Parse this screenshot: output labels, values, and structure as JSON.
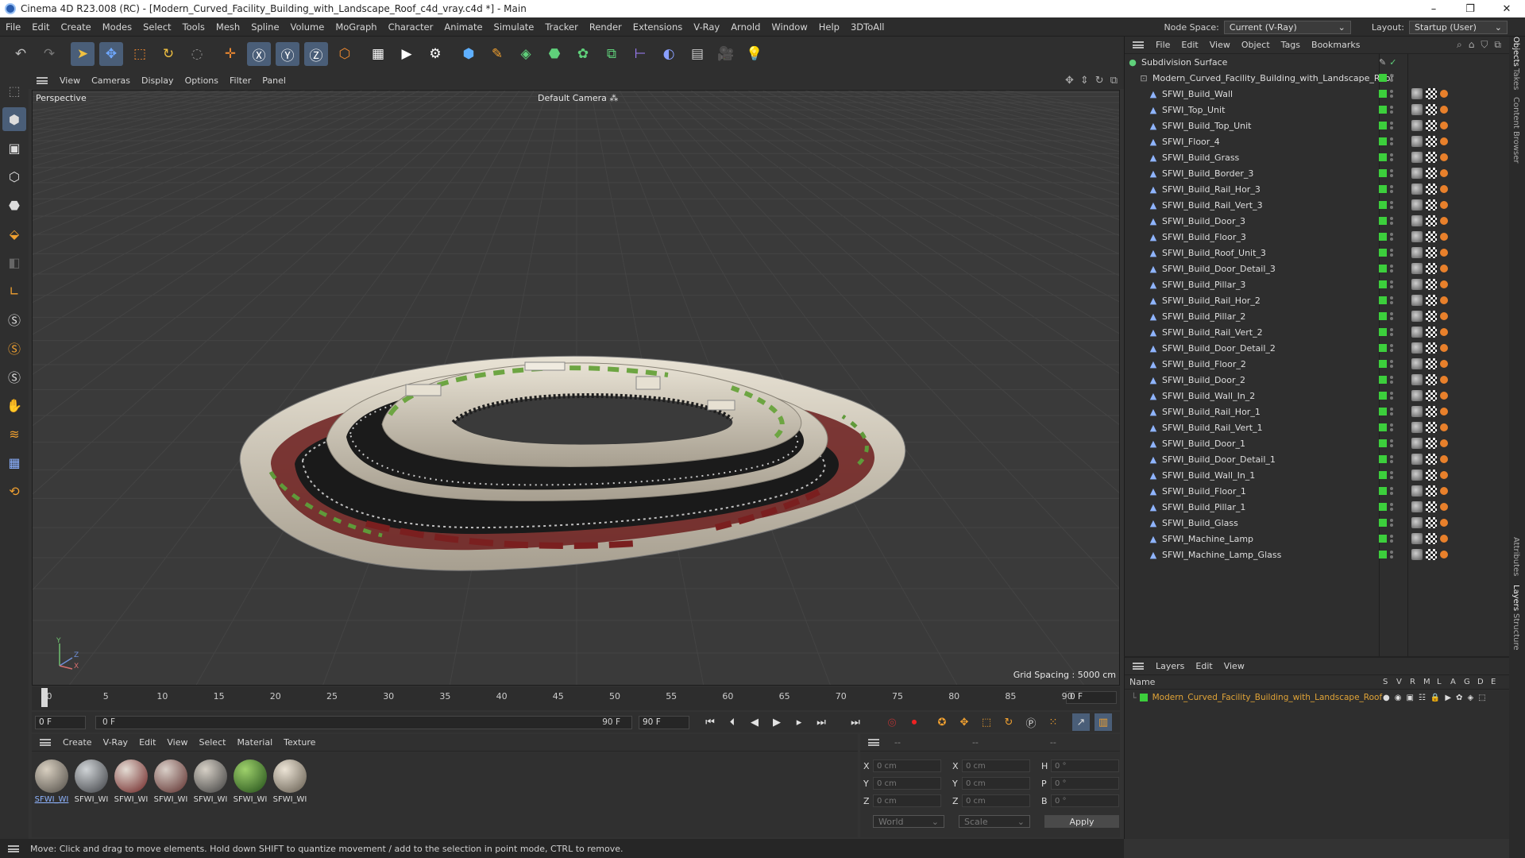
{
  "window": {
    "title": "Cinema 4D R23.008 (RC) - [Modern_Curved_Facility_Building_with_Landscape_Roof_c4d_vray.c4d *] - Main",
    "controls": [
      "–",
      "❐",
      "✕"
    ]
  },
  "menubar": {
    "items": [
      "File",
      "Edit",
      "Create",
      "Modes",
      "Select",
      "Tools",
      "Mesh",
      "Spline",
      "Volume",
      "MoGraph",
      "Character",
      "Animate",
      "Simulate",
      "Tracker",
      "Render",
      "Extensions",
      "V-Ray",
      "Arnold",
      "Window",
      "Help",
      "3DToAll"
    ],
    "node_space_label": "Node Space:",
    "node_space_value": "Current (V-Ray)",
    "layout_label": "Layout:",
    "layout_value": "Startup (User)"
  },
  "toolbar": {
    "icons": [
      "undo-icon",
      "redo-icon",
      "live-select-icon",
      "move-icon",
      "scale-icon",
      "rotate-icon",
      "recent-tool-icon",
      "axis-icon",
      "x-axis-icon",
      "y-axis-icon",
      "z-axis-icon",
      "coordinate-system-icon",
      "render-region-icon",
      "render-view-icon",
      "render-settings-icon",
      "cube-icon",
      "pen-icon",
      "subdivision-icon",
      "extrude-icon",
      "cloner-icon",
      "bend-icon",
      "measure-icon",
      "field-icon",
      "floor-icon",
      "camera-icon",
      "light-icon"
    ],
    "glyphs": [
      "↶",
      "↷",
      "➤",
      "✥",
      "⬚",
      "↻",
      "◌",
      "✛",
      "Ⓧ",
      "Ⓨ",
      "Ⓩ",
      "⬡",
      "▦",
      "▶",
      "⚙",
      "⬢",
      "✎",
      "◈",
      "⬣",
      "✿",
      "⧉",
      "⊢",
      "◐",
      "▤",
      "🎥",
      "💡"
    ]
  },
  "left_tools": {
    "icons": [
      "make-editable-icon",
      "model-mode-icon",
      "texture-mode-icon",
      "points-mode-icon",
      "edges-mode-icon",
      "polygons-mode-icon",
      "object-axis-icon",
      "workplane-icon",
      "snap-icon-1",
      "snap-icon-2",
      "snap-icon-3",
      "magnet-icon",
      "layer-floor-icon",
      "grid-icon",
      "soft-selection-icon"
    ],
    "glyphs": [
      "⬚",
      "⬢",
      "▣",
      "⬡",
      "⬣",
      "⬙",
      "◧",
      "∟",
      "Ⓢ",
      "Ⓢ",
      "Ⓢ",
      "✋",
      "≋",
      "▦",
      "⟲"
    ]
  },
  "viewport_header": {
    "menus": [
      "View",
      "Cameras",
      "Display",
      "Options",
      "Filter",
      "Panel"
    ]
  },
  "viewport": {
    "view_name": "Perspective",
    "camera": "Default Camera",
    "grid_spacing": "Grid Spacing : 5000 cm",
    "axis_labels": {
      "y": "Y",
      "z": "Z",
      "x": "X"
    }
  },
  "timeline": {
    "ticks": [
      "0",
      "5",
      "10",
      "15",
      "20",
      "25",
      "30",
      "35",
      "40",
      "45",
      "50",
      "55",
      "60",
      "65",
      "70",
      "75",
      "80",
      "85",
      "90"
    ],
    "current_frame": "0 F"
  },
  "transport": {
    "start_frame": "0 F",
    "range_start": "0 F",
    "range_end": "90 F",
    "end_frame": "90 F",
    "buttons": [
      "⏮",
      "⏴",
      "◀",
      "▶",
      "▸",
      "⏭",
      "⏭"
    ],
    "right_icons": [
      "◎",
      "⏺",
      "✪",
      "✥",
      "⬚",
      "↻",
      "Ⓟ",
      "⁙",
      "↗",
      "▥"
    ]
  },
  "material_panel": {
    "menus": [
      "Create",
      "V-Ray",
      "Edit",
      "View",
      "Select",
      "Material",
      "Texture"
    ],
    "materials": [
      {
        "name": "SFWI_WI",
        "colors": [
          "#d8cfc0",
          "#4e4a44"
        ],
        "selected": true
      },
      {
        "name": "SFWI_WI",
        "colors": [
          "#cfd3d6",
          "#3a3c40"
        ],
        "selected": false
      },
      {
        "name": "SFWI_WI",
        "colors": [
          "#e4dcd4",
          "#6b1f1f"
        ],
        "selected": false
      },
      {
        "name": "SFWI_WI",
        "colors": [
          "#d9cfc8",
          "#5a2a28"
        ],
        "selected": false
      },
      {
        "name": "SFWI_WI",
        "colors": [
          "#d6d0c6",
          "#3b3b3b"
        ],
        "selected": false
      },
      {
        "name": "SFWI_WI",
        "colors": [
          "#9ed16b",
          "#1f4a17"
        ],
        "selected": false
      },
      {
        "name": "SFWI_WI",
        "colors": [
          "#ece4d6",
          "#5f574a"
        ],
        "selected": false
      }
    ]
  },
  "coordinates": {
    "headers": [
      "--",
      "--",
      "--"
    ],
    "rows": [
      {
        "a": "X",
        "av": "0 cm",
        "b": "X",
        "bv": "0 cm",
        "c": "H",
        "cv": "0 °"
      },
      {
        "a": "Y",
        "av": "0 cm",
        "b": "Y",
        "bv": "0 cm",
        "c": "P",
        "cv": "0 °"
      },
      {
        "a": "Z",
        "av": "0 cm",
        "b": "Z",
        "bv": "0 cm",
        "c": "B",
        "cv": "0 °"
      }
    ],
    "mode": "World",
    "type": "Scale",
    "apply": "Apply"
  },
  "status": {
    "text": "Move: Click and drag to move elements. Hold down SHIFT to quantize movement / add to the selection in point mode, CTRL to remove."
  },
  "objects_panel": {
    "menus": [
      "File",
      "Edit",
      "View",
      "Object",
      "Tags",
      "Bookmarks"
    ],
    "root": "Subdivision Surface",
    "group": "Modern_Curved_Facility_Building_with_Landscape_Roof",
    "items": [
      "SFWI_Build_Wall",
      "SFWI_Top_Unit",
      "SFWI_Build_Top_Unit",
      "SFWI_Floor_4",
      "SFWI_Build_Grass",
      "SFWI_Build_Border_3",
      "SFWI_Build_Rail_Hor_3",
      "SFWI_Build_Rail_Vert_3",
      "SFWI_Build_Door_3",
      "SFWI_Build_Floor_3",
      "SFWI_Build_Roof_Unit_3",
      "SFWI_Build_Door_Detail_3",
      "SFWI_Build_Pillar_3",
      "SFWI_Build_Rail_Hor_2",
      "SFWI_Build_Pillar_2",
      "SFWI_Build_Rail_Vert_2",
      "SFWI_Build_Door_Detail_2",
      "SFWI_Build_Floor_2",
      "SFWI_Build_Door_2",
      "SFWI_Build_Wall_In_2",
      "SFWI_Build_Rail_Hor_1",
      "SFWI_Build_Rail_Vert_1",
      "SFWI_Build_Door_1",
      "SFWI_Build_Door_Detail_1",
      "SFWI_Build_Wall_In_1",
      "SFWI_Build_Floor_1",
      "SFWI_Build_Pillar_1",
      "SFWI_Build_Glass",
      "SFWI_Machine_Lamp",
      "SFWI_Machine_Lamp_Glass"
    ]
  },
  "layers_panel": {
    "menus": [
      "Layers",
      "Edit",
      "View"
    ],
    "name_header": "Name",
    "columns": [
      "S",
      "V",
      "R",
      "M",
      "L",
      "A",
      "G",
      "D",
      "E"
    ],
    "layer_name": "Modern_Curved_Facility_Building_with_Landscape_Roof",
    "layer_color": "#3ccf3c"
  },
  "right_tabs": [
    "Objects",
    "Takes",
    "Content Browser",
    "Attributes",
    "Layers",
    "Structure"
  ]
}
